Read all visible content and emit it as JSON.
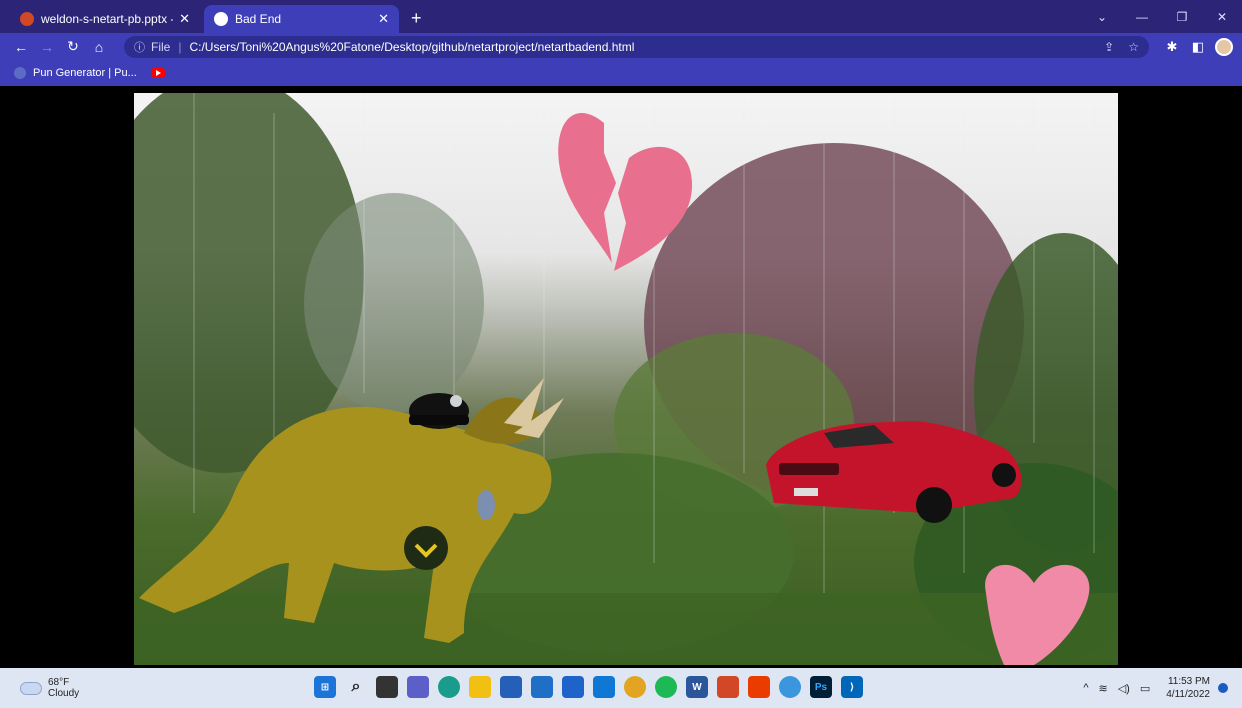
{
  "tabs": [
    {
      "title": "weldon-s-netart-pb.pptx - Micro",
      "active": false
    },
    {
      "title": "Bad End",
      "active": true
    }
  ],
  "new_tab": "+",
  "address_bar": {
    "scheme_label": "File",
    "url": "C:/Users/Toni%20Angus%20Fatone/Desktop/github/netartproject/netartbadend.html"
  },
  "bookmarks": [
    {
      "label": "Pun Generator | Pu..."
    },
    {
      "label": ""
    }
  ],
  "scene": {
    "elements": [
      "broken-heart",
      "triceratops-with-police-hat",
      "red-sports-car",
      "pink-heart"
    ]
  },
  "taskbar": {
    "weather": {
      "temp": "68°F",
      "condition": "Cloudy"
    },
    "pinned": [
      "start",
      "search",
      "task-view",
      "teams",
      "edge",
      "file-explorer",
      "store",
      "mail",
      "calendar",
      "outlook",
      "chrome",
      "spotify",
      "word",
      "office-app",
      "office",
      "photos",
      "photoshop",
      "vscode"
    ],
    "clock": {
      "time": "11:53 PM",
      "date": "4/11/2022"
    }
  },
  "colors": {
    "titlebar": "#2c2477",
    "toolbar": "#3e3fb8",
    "taskbar": "#dfe6f3"
  }
}
